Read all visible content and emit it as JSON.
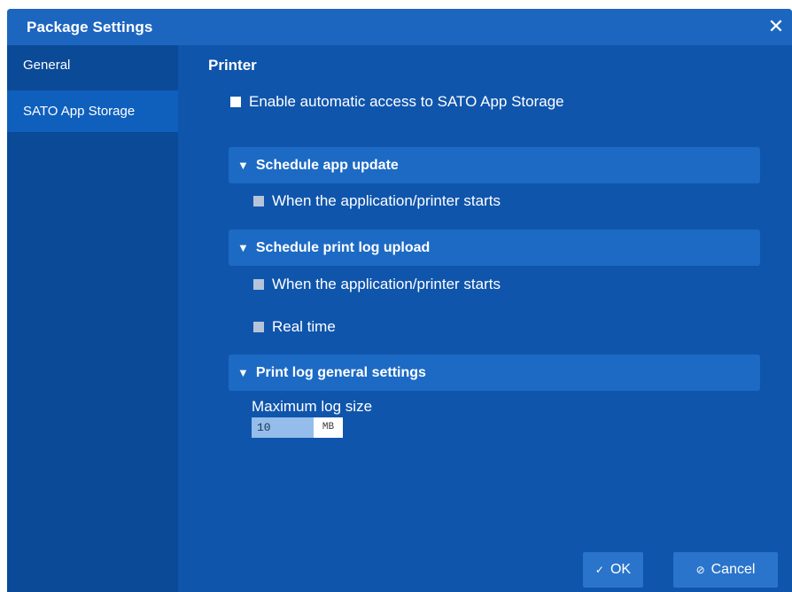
{
  "dialog": {
    "title": "Package Settings",
    "close_glyph": "✕"
  },
  "sidebar": {
    "items": [
      {
        "label": "General",
        "active": false
      },
      {
        "label": "SATO App Storage",
        "active": true
      }
    ]
  },
  "main": {
    "section_title": "Printer",
    "enable_access": {
      "label": "Enable automatic access to SATO App Storage",
      "checked": false
    },
    "groups": [
      {
        "title": "Schedule app update",
        "options": [
          {
            "label": "When the application/printer starts",
            "checked": false
          }
        ]
      },
      {
        "title": "Schedule print log upload",
        "options": [
          {
            "label": "When the application/printer starts",
            "checked": false
          },
          {
            "label": "Real time",
            "checked": false
          }
        ]
      },
      {
        "title": "Print log general settings",
        "options": []
      }
    ],
    "max_log_size": {
      "label": "Maximum log size",
      "value": "10",
      "unit": "MB"
    }
  },
  "buttons": {
    "ok_label": "OK",
    "ok_icon": "✓",
    "cancel_label": "Cancel",
    "cancel_icon": "⊘"
  },
  "icons": {
    "expand": "▼"
  },
  "colors": {
    "background": "#0f55ac",
    "titlebar": "#1d66c0",
    "sidebar": "#0a4a97",
    "sidebar_active": "#0f5fbd",
    "group_bar": "#1d6ac4",
    "button": "#2a74cc"
  }
}
